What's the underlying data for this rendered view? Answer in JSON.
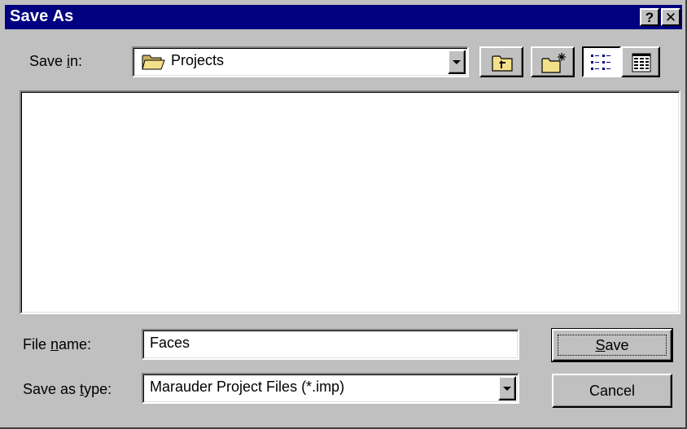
{
  "window": {
    "title": "Save As"
  },
  "titlebar": {
    "help_label": "?",
    "close_label": "✕"
  },
  "save_in": {
    "label_pre": "Save ",
    "label_key": "i",
    "label_post": "n:",
    "value": "Projects"
  },
  "toolbar": {
    "up_icon": "up-one-level-icon",
    "new_folder_icon": "new-folder-icon",
    "list_icon": "list-view-icon",
    "details_icon": "details-view-icon"
  },
  "file_list": {
    "items": []
  },
  "file_name": {
    "label_pre": "File ",
    "label_key": "n",
    "label_post": "ame:",
    "value": "Faces"
  },
  "save_as_type": {
    "label_pre": "Save as ",
    "label_key": "t",
    "label_post": "ype:",
    "value": "Marauder Project Files (*.imp)"
  },
  "buttons": {
    "save_key": "S",
    "save_rest": "ave",
    "cancel": "Cancel"
  },
  "colors": {
    "titlebar": "#000080",
    "face": "#c0c0c0",
    "folder": "#f5e08a"
  }
}
